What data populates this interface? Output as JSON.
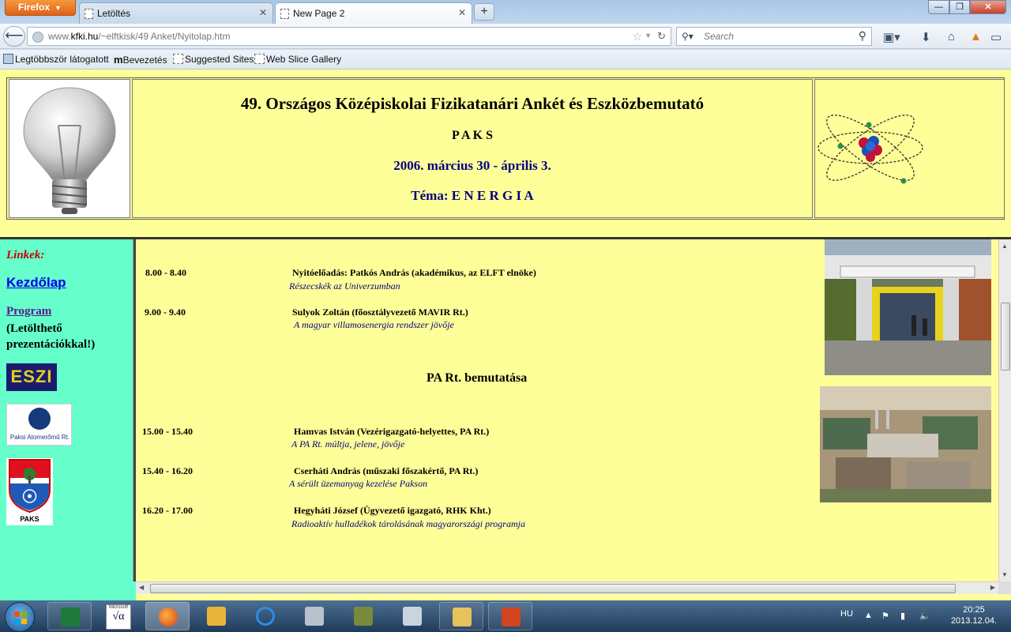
{
  "browser": {
    "menu_button": "Firefox",
    "tabs": [
      {
        "label": "Letöltés",
        "active": false
      },
      {
        "label": "New Page 2",
        "active": true
      }
    ],
    "url_prefix": "www.",
    "url_domain": "kfki.hu",
    "url_path": "/~elftkisk/49 Anket/Nyitolap.htm",
    "search_placeholder": "Search",
    "bookmarks": [
      "Legtöbbször látogatott",
      "Bevezetés",
      "Suggested Sites",
      "Web Slice Gallery"
    ]
  },
  "header": {
    "title": "49. Országos Középiskolai Fizikatanári Ankét és Eszközbemutató",
    "city": "P A K S",
    "dates": "2006. március 30 - április 3.",
    "theme_label": "Téma: ",
    "theme": "E N E R G I A"
  },
  "sidebar": {
    "links_heading": "Linkek:",
    "home_link": "Kezdőlap",
    "program_link": "Program",
    "program_note": "(Letölthető prezentációkkal!)",
    "eszi_logo": "ESZI",
    "paks_npp_logo": "Paksi Atomerőmű Rt.",
    "paks_coat": "PAKS"
  },
  "schedule": [
    {
      "time": "8.00 -  8.40",
      "speaker": "Nyitóelőadás: Patkós András (akadémikus, az ELFT elnöke)",
      "talk": "Részecskék az Univerzumban"
    },
    {
      "time": "9.00 -  9.40",
      "speaker": "Sulyok Zoltán  (főosztályvezető MAVIR Rt.)",
      "talk": "A magyar villamosenergia rendszer jövője"
    }
  ],
  "section_title": "PA Rt. bemutatása",
  "schedule2": [
    {
      "time": "15.00 - 15.40",
      "speaker": "Hamvas István (Vezérigazgató-helyettes, PA Rt.)",
      "talk": "A PA Rt. múltja, jelene, jövője"
    },
    {
      "time": "15.40 - 16.20",
      "speaker": "Cserháti András (műszaki főszakértő, PA Rt.)",
      "talk": "A sérült üzemanyag kezelése Pakson"
    },
    {
      "time": "16.20 - 17.00",
      "speaker": "Hegyháti József (Ügyvezető igazgató, RHK Kht.)",
      "talk": "Radioaktív  hulladékok tárolásának magyarországi programja"
    }
  ],
  "taskbar": {
    "lang": "HU",
    "time": "20:25",
    "date": "2013.12.04.",
    "app_label": "Microsoft"
  }
}
